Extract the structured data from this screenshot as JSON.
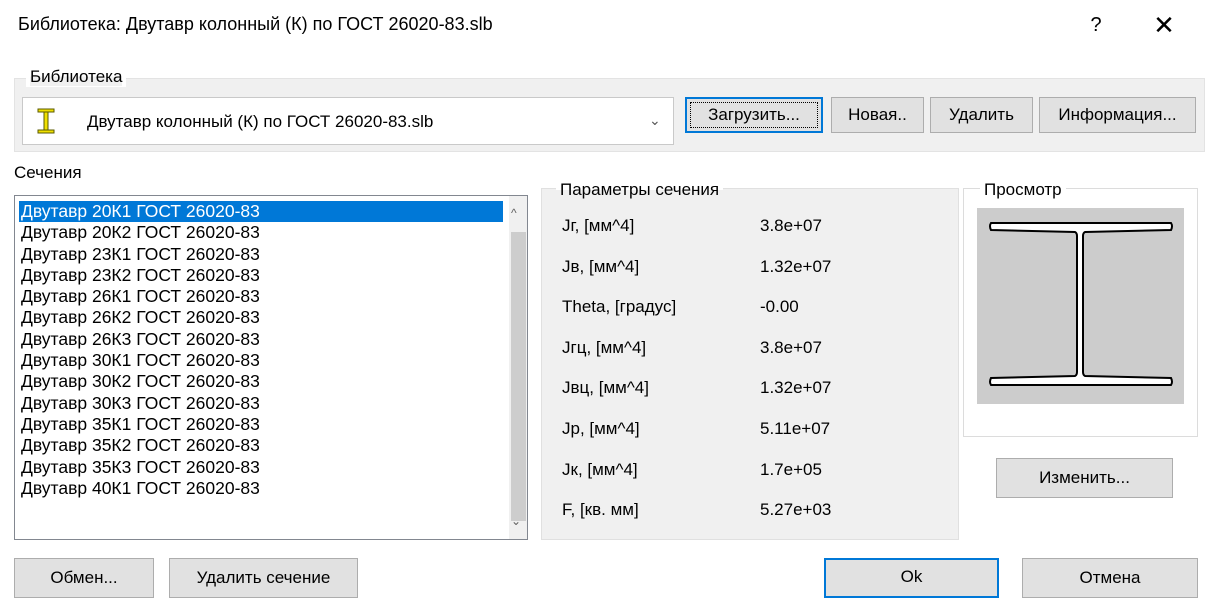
{
  "window": {
    "title": "Библиотека: Двутавр колонный (К) по ГОСТ 26020-83.slb",
    "help_label": "?",
    "close_label": "✕"
  },
  "library": {
    "group_label": "Библиотека",
    "selected": "Двутавр колонный (К) по ГОСТ 26020-83.slb",
    "icon": "i-beam-icon",
    "buttons": {
      "load": "Загрузить...",
      "new": "Новая..",
      "delete": "Удалить",
      "info": "Информация..."
    }
  },
  "sections": {
    "label": "Сечения",
    "items": [
      "Двутавр 20К1 ГОСТ 26020-83",
      "Двутавр 20К2 ГОСТ 26020-83",
      "Двутавр 23К1 ГОСТ 26020-83",
      "Двутавр 23К2 ГОСТ 26020-83",
      "Двутавр 26К1 ГОСТ 26020-83",
      "Двутавр 26К2 ГОСТ 26020-83",
      "Двутавр 26К3 ГОСТ 26020-83",
      "Двутавр 30К1 ГОСТ 26020-83",
      "Двутавр 30К2 ГОСТ 26020-83",
      "Двутавр 30К3 ГОСТ 26020-83",
      "Двутавр 35К1 ГОСТ 26020-83",
      "Двутавр 35К2 ГОСТ 26020-83",
      "Двутавр 35К3 ГОСТ 26020-83",
      "Двутавр 40К1 ГОСТ 26020-83"
    ],
    "selected_index": 0
  },
  "params": {
    "label": "Параметры сечения",
    "rows": [
      {
        "name": "Jг, [мм^4]",
        "value": "3.8e+07"
      },
      {
        "name": "Jв, [мм^4]",
        "value": "1.32e+07"
      },
      {
        "name": "Theta, [градус]",
        "value": "-0.00"
      },
      {
        "name": "Jгц, [мм^4]",
        "value": "3.8e+07"
      },
      {
        "name": "Jвц, [мм^4]",
        "value": "1.32e+07"
      },
      {
        "name": "Jр, [мм^4]",
        "value": "5.11e+07"
      },
      {
        "name": "Jк, [мм^4]",
        "value": "1.7e+05"
      },
      {
        "name": "F, [кв. мм]",
        "value": "5.27e+03"
      }
    ]
  },
  "preview": {
    "label": "Просмотр",
    "change_button": "Изменить..."
  },
  "footer": {
    "exchange": "Обмен...",
    "delete_section": "Удалить сечение",
    "ok": "Ok",
    "cancel": "Отмена"
  }
}
